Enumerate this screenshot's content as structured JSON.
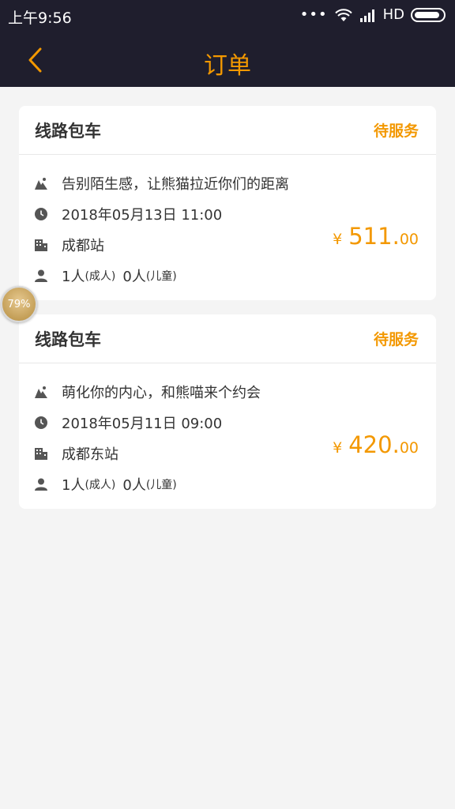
{
  "status_bar": {
    "time": "上午9:56",
    "dots": "•••",
    "network": "HD"
  },
  "nav": {
    "title": "订单"
  },
  "orders": [
    {
      "type": "线路包车",
      "status": "待服务",
      "route": "告别陌生感，让熊猫拉近你们的距离",
      "datetime": "2018年05月13日 11:00",
      "station": "成都站",
      "adults_count": "1人",
      "adults_label": "(成人)",
      "children_count": "0人",
      "children_label": "(儿童)",
      "currency": "¥",
      "price_integer": "511.",
      "price_decimal": "00"
    },
    {
      "type": "线路包车",
      "status": "待服务",
      "route": "萌化你的内心，和熊喵来个约会",
      "datetime": "2018年05月11日 09:00",
      "station": "成都东站",
      "adults_count": "1人",
      "adults_label": "(成人)",
      "children_count": "0人",
      "children_label": "(儿童)",
      "currency": "¥",
      "price_integer": "420.",
      "price_decimal": "00"
    }
  ],
  "progress_badge": "79%",
  "colors": {
    "accent": "#f39800",
    "nav_bg": "#1f1e2d",
    "page_bg": "#f4f4f4"
  },
  "icons": [
    "chevron-left-icon",
    "mountain-icon",
    "clock-icon",
    "building-icon",
    "person-icon",
    "wifi-icon",
    "signal-icon",
    "battery-icon"
  ]
}
